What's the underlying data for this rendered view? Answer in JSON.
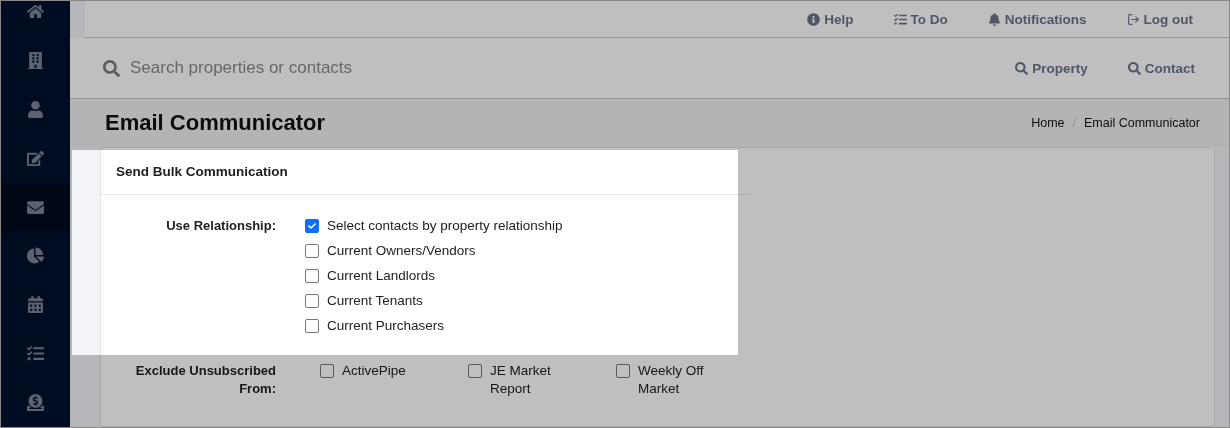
{
  "sidebar": {
    "items": [
      {
        "selected": false
      },
      {
        "selected": false
      },
      {
        "selected": false
      },
      {
        "selected": false
      },
      {
        "selected": true
      },
      {
        "selected": false
      },
      {
        "selected": false
      },
      {
        "selected": false
      },
      {
        "selected": false
      }
    ]
  },
  "top_links": [
    {
      "label": "Help"
    },
    {
      "label": "To Do"
    },
    {
      "label": "Notifications"
    },
    {
      "label": "Log out"
    }
  ],
  "search": {
    "placeholder": "Search properties or contacts",
    "buttons": [
      "Property",
      "Contact"
    ]
  },
  "page_title": "Email Communicator",
  "breadcrumb": {
    "separator": "/",
    "items": [
      "Home",
      "Email Communicator"
    ]
  },
  "card": {
    "title": "Send Bulk Communication",
    "relationship": {
      "label": "Use Relationship:",
      "options": [
        {
          "label": "Select contacts by property relationship",
          "checked": true
        },
        {
          "label": "Current Owners/Vendors",
          "checked": false
        },
        {
          "label": "Current Landlords",
          "checked": false
        },
        {
          "label": "Current Tenants",
          "checked": false
        },
        {
          "label": "Current Purchasers",
          "checked": false
        }
      ]
    },
    "exclude": {
      "label": "Exclude Unsubscribed From:",
      "options": [
        {
          "label": "ActivePipe",
          "checked": false
        },
        {
          "label": "JE Market Report",
          "checked": false
        },
        {
          "label": "Weekly Off Market",
          "checked": false
        }
      ]
    }
  }
}
